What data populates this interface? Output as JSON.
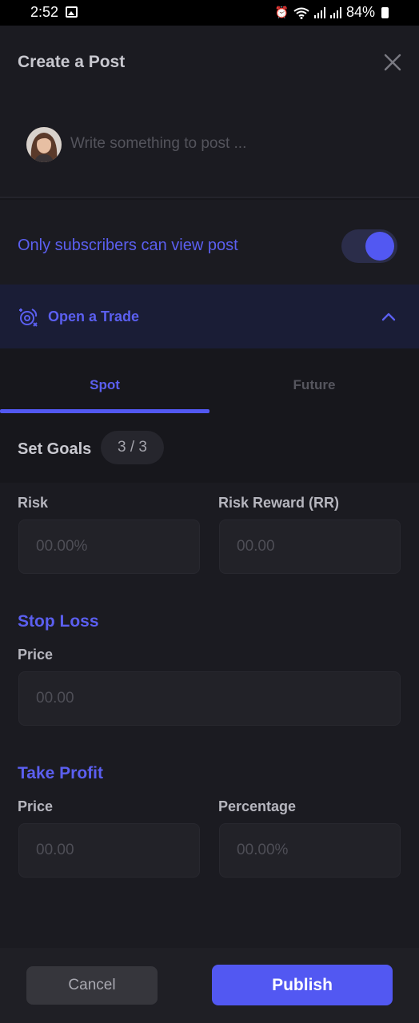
{
  "status_bar": {
    "time": "2:52",
    "battery": "84%",
    "icons": [
      "image-icon",
      "alarm-icon",
      "wifi-icon",
      "signal-icon",
      "signal-icon",
      "battery-icon"
    ]
  },
  "header": {
    "title": "Create a Post",
    "close_icon": "close-icon"
  },
  "composer": {
    "placeholder": "Write something to post ...",
    "avatar": "user-avatar"
  },
  "visibility": {
    "label": "Only subscribers can view post",
    "toggle_on": true
  },
  "trade": {
    "label": "Open a Trade",
    "icon": "target-icon",
    "expanded": true
  },
  "tabs": [
    {
      "label": "Spot",
      "active": true
    },
    {
      "label": "Future",
      "active": false
    }
  ],
  "goals": {
    "label": "Set Goals",
    "count": "3 / 3"
  },
  "risk": {
    "risk_label": "Risk",
    "risk_placeholder": "00.00%",
    "rr_label": "Risk Reward (RR)",
    "rr_placeholder": "00.00"
  },
  "stop_loss": {
    "title": "Stop Loss",
    "price_label": "Price",
    "price_placeholder": "00.00"
  },
  "take_profit": {
    "title": "Take Profit",
    "price_label": "Price",
    "price_placeholder": "00.00",
    "percentage_label": "Percentage",
    "percentage_placeholder": "00.00%"
  },
  "footer": {
    "cancel_label": "Cancel",
    "publish_label": "Publish"
  },
  "colors": {
    "accent": "#5258f2",
    "background": "#17171c",
    "surface": "#1b1b21"
  }
}
